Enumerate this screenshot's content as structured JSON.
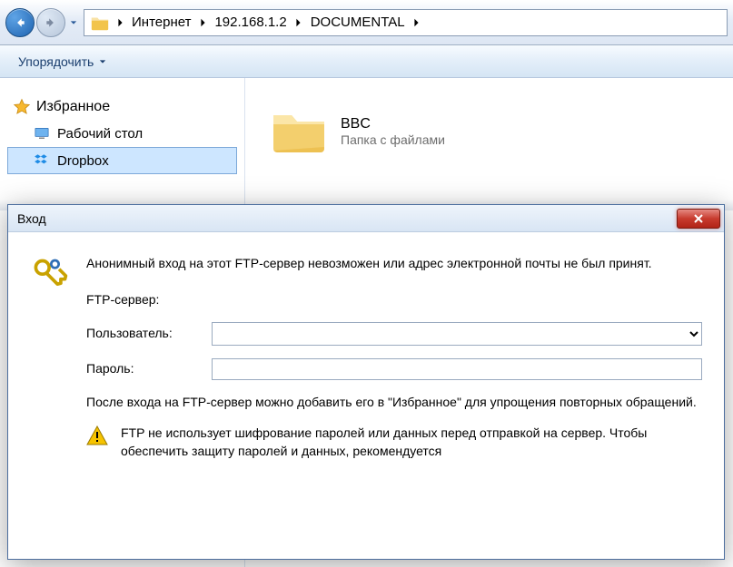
{
  "breadcrumb": {
    "seg1": "Интернет",
    "seg2": "192.168.1.2",
    "seg3": "DOCUMENTAL"
  },
  "toolbar": {
    "organize": "Упорядочить"
  },
  "sidebar": {
    "favorites_header": "Избранное",
    "item_desktop": "Рабочий стол",
    "item_dropbox": "Dropbox"
  },
  "content": {
    "folder_name": "BBC",
    "folder_sub": "Папка с файлами"
  },
  "dialog": {
    "title": "Вход",
    "message": "Анонимный вход на этот FTP-сервер невозможен или адрес электронной почты не был принят.",
    "ftp_label": "FTP-сервер:",
    "user_label": "Пользователь:",
    "pass_label": "Пароль:",
    "note": "После входа на FTP-сервер можно добавить его в \"Избранное\" для упрощения повторных обращений.",
    "warn": "FTP не использует шифрование паролей или данных перед отправкой на сервер. Чтобы обеспечить защиту паролей и данных, рекомендуется"
  }
}
